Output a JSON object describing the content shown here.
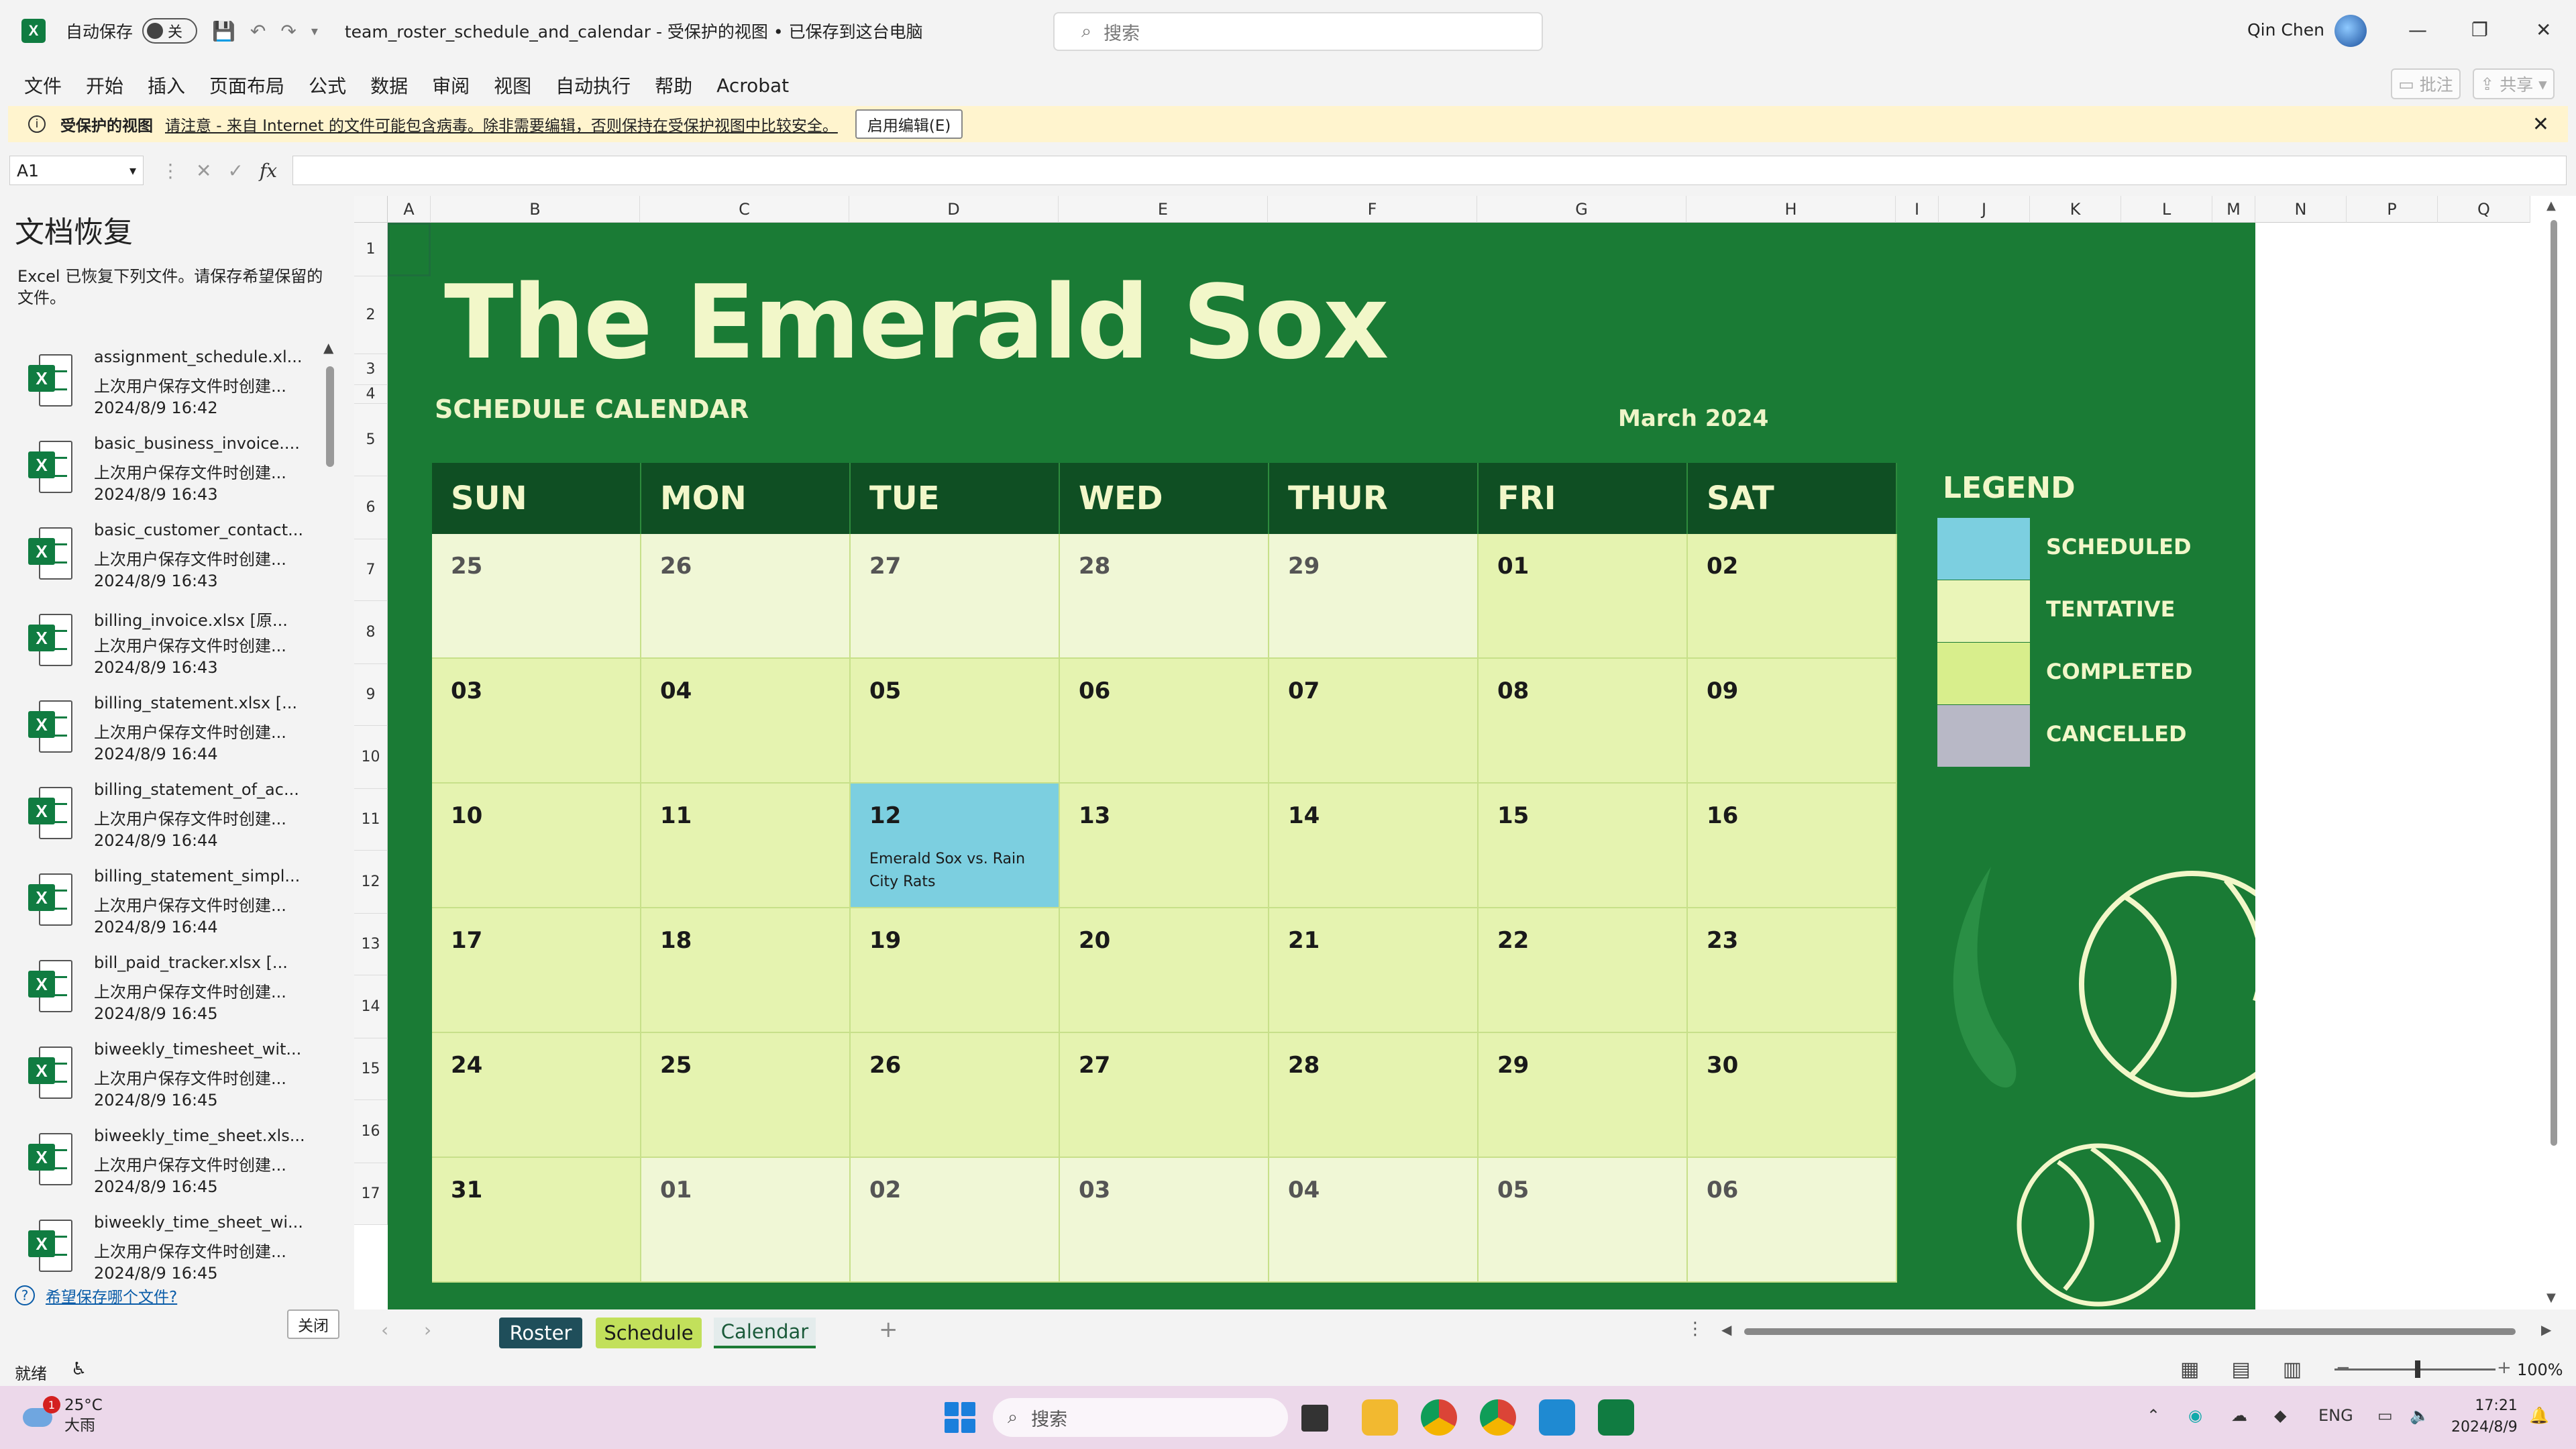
{
  "titlebar": {
    "autosave_label": "自动保存",
    "autosave_state": "关",
    "doc_title": "team_roster_schedule_and_calendar - 受保护的视图 • 已保存到这台电脑",
    "search_placeholder": "搜索",
    "user_name": "Qin Chen"
  },
  "ribbon": {
    "tabs": [
      "文件",
      "开始",
      "插入",
      "页面布局",
      "公式",
      "数据",
      "审阅",
      "视图",
      "自动执行",
      "帮助",
      "Acrobat"
    ],
    "comment_btn": "批注",
    "share_btn": "共享"
  },
  "protected_view": {
    "title": "受保护的视图",
    "message": "请注意 - 来自 Internet 的文件可能包含病毒。除非需要编辑，否则保持在受保护视图中比较安全。",
    "enable_button": "启用编辑(E)"
  },
  "formula_bar": {
    "cell_ref": "A1",
    "fx": "fx",
    "formula": ""
  },
  "recovery": {
    "title": "文档恢复",
    "description": "Excel 已恢复下列文件。请保存希望保留的文件。",
    "files": [
      {
        "name": "assignment_schedule.xl...",
        "sub": "上次用户保存文件时创建...",
        "date": "2024/8/9 16:42"
      },
      {
        "name": "basic_business_invoice....",
        "sub": "上次用户保存文件时创建...",
        "date": "2024/8/9 16:43"
      },
      {
        "name": "basic_customer_contact...",
        "sub": "上次用户保存文件时创建...",
        "date": "2024/8/9 16:43"
      },
      {
        "name": "billing_invoice.xlsx  [原...",
        "sub": "上次用户保存文件时创建...",
        "date": "2024/8/9 16:43"
      },
      {
        "name": "billing_statement.xlsx  [...",
        "sub": "上次用户保存文件时创建...",
        "date": "2024/8/9 16:44"
      },
      {
        "name": "billing_statement_of_ac...",
        "sub": "上次用户保存文件时创建...",
        "date": "2024/8/9 16:44"
      },
      {
        "name": "billing_statement_simpl...",
        "sub": "上次用户保存文件时创建...",
        "date": "2024/8/9 16:44"
      },
      {
        "name": "bill_paid_tracker.xlsx  [...",
        "sub": "上次用户保存文件时创建...",
        "date": "2024/8/9 16:45"
      },
      {
        "name": "biweekly_timesheet_wit...",
        "sub": "上次用户保存文件时创建...",
        "date": "2024/8/9 16:45"
      },
      {
        "name": "biweekly_time_sheet.xls...",
        "sub": "上次用户保存文件时创建...",
        "date": "2024/8/9 16:45"
      },
      {
        "name": "biweekly_time_sheet_wi...",
        "sub": "上次用户保存文件时创建...",
        "date": "2024/8/9 16:45"
      }
    ],
    "help_link": "希望保存哪个文件?",
    "close_button": "关闭"
  },
  "sheet": {
    "columns": [
      "A",
      "B",
      "C",
      "D",
      "E",
      "F",
      "G",
      "H",
      "I",
      "J",
      "K",
      "L",
      "M",
      "N",
      "P",
      "Q"
    ],
    "rows": [
      "1",
      "2",
      "3",
      "4",
      "5",
      "6",
      "7",
      "8",
      "9",
      "10",
      "11",
      "12",
      "13",
      "14",
      "15",
      "16",
      "17"
    ],
    "team_name": "The Emerald Sox",
    "subtitle": "SCHEDULE CALENDAR",
    "month": "March 2024",
    "days": [
      "SUN",
      "MON",
      "TUE",
      "WED",
      "THUR",
      "FRI",
      "SAT"
    ],
    "weeks": [
      [
        {
          "d": "25",
          "s": "tent",
          "m": true
        },
        {
          "d": "26",
          "s": "tent",
          "m": true
        },
        {
          "d": "27",
          "s": "tent",
          "m": true
        },
        {
          "d": "28",
          "s": "tent",
          "m": true
        },
        {
          "d": "29",
          "s": "tent",
          "m": true
        },
        {
          "d": "01",
          "s": "comp"
        },
        {
          "d": "02",
          "s": "comp"
        }
      ],
      [
        {
          "d": "03",
          "s": "comp"
        },
        {
          "d": "04",
          "s": "comp"
        },
        {
          "d": "05",
          "s": "comp"
        },
        {
          "d": "06",
          "s": "comp"
        },
        {
          "d": "07",
          "s": "comp"
        },
        {
          "d": "08",
          "s": "comp"
        },
        {
          "d": "09",
          "s": "comp"
        }
      ],
      [
        {
          "d": "10",
          "s": "comp"
        },
        {
          "d": "11",
          "s": "comp"
        },
        {
          "d": "12",
          "s": "sched",
          "e": "Emerald Sox vs. Rain City Rats"
        },
        {
          "d": "13",
          "s": "comp"
        },
        {
          "d": "14",
          "s": "comp"
        },
        {
          "d": "15",
          "s": "comp"
        },
        {
          "d": "16",
          "s": "comp"
        }
      ],
      [
        {
          "d": "17",
          "s": "comp"
        },
        {
          "d": "18",
          "s": "comp"
        },
        {
          "d": "19",
          "s": "comp"
        },
        {
          "d": "20",
          "s": "comp"
        },
        {
          "d": "21",
          "s": "comp"
        },
        {
          "d": "22",
          "s": "comp"
        },
        {
          "d": "23",
          "s": "comp"
        }
      ],
      [
        {
          "d": "24",
          "s": "comp"
        },
        {
          "d": "25",
          "s": "comp"
        },
        {
          "d": "26",
          "s": "comp"
        },
        {
          "d": "27",
          "s": "comp"
        },
        {
          "d": "28",
          "s": "comp"
        },
        {
          "d": "29",
          "s": "comp"
        },
        {
          "d": "30",
          "s": "comp"
        }
      ],
      [
        {
          "d": "31",
          "s": "comp"
        },
        {
          "d": "01",
          "s": "tent",
          "m": true
        },
        {
          "d": "02",
          "s": "tent",
          "m": true
        },
        {
          "d": "03",
          "s": "tent",
          "m": true
        },
        {
          "d": "04",
          "s": "tent",
          "m": true
        },
        {
          "d": "05",
          "s": "tent",
          "m": true
        },
        {
          "d": "06",
          "s": "tent",
          "m": true
        }
      ]
    ],
    "legend_title": "LEGEND",
    "legend": [
      {
        "label": "SCHEDULED",
        "color": "#7ccfe0"
      },
      {
        "label": "TENTATIVE",
        "color": "#eaf5b8"
      },
      {
        "label": "COMPLETED",
        "color": "#d8ee8c"
      },
      {
        "label": "CANCELLED",
        "color": "#b8b8c6"
      }
    ]
  },
  "sheet_tabs": [
    "Roster",
    "Schedule",
    "Calendar"
  ],
  "statusbar": {
    "ready": "就绪",
    "zoom": "100%"
  },
  "taskbar": {
    "temp": "25°C",
    "weather": "大雨",
    "weather_badge": "1",
    "search": "搜索",
    "lang": "ENG",
    "time": "17:21",
    "date": "2024/8/9"
  },
  "colors": {
    "sheet_bg": "#1a7b35",
    "header_dark": "#0f4f23",
    "title_text": "#f2f7c9",
    "excel_green": "#107c41"
  }
}
